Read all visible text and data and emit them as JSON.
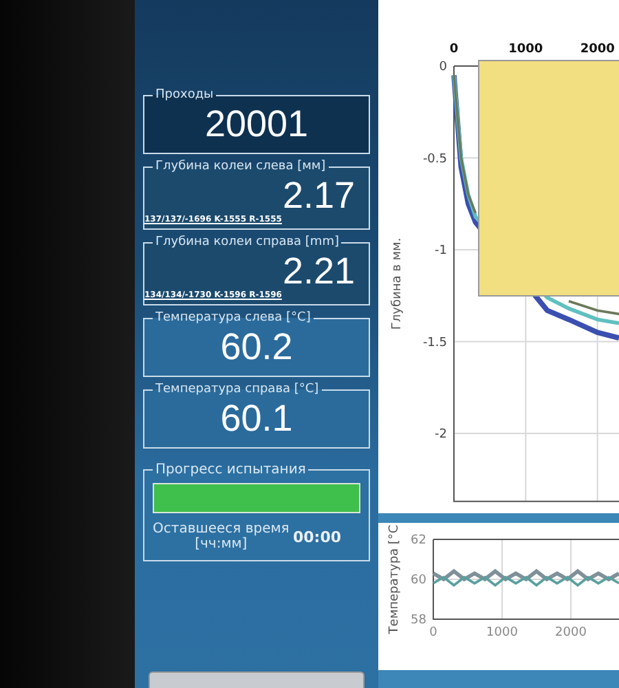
{
  "panels": [
    {
      "kind": "count",
      "label": "Проходы",
      "value": "20001"
    },
    {
      "kind": "depth",
      "label": "Глубина колеи слева [мм]",
      "value": "2.17",
      "note": "137/137/-1696  K-1555 R-1555"
    },
    {
      "kind": "depth",
      "label": "Глубина колеи справа [mm]",
      "value": "2.21",
      "note": "134/134/-1730  K-1596 R-1596"
    },
    {
      "kind": "temperature",
      "label": "Температура слева [°C]",
      "value": "60.2"
    },
    {
      "kind": "temperature",
      "label": "Температура справа [°C]",
      "value": "60.1"
    }
  ],
  "progress": {
    "label": "Прогресс испытания",
    "level": 1,
    "remaining_label": "Оставшееся время",
    "remaining_unit": "[чч:мм]",
    "remaining_value": "00:00"
  },
  "depth_chart": {
    "chart_data": {
      "type": "line",
      "ylabel": "Глубина в мм.",
      "xticks": [
        0,
        1000,
        2000
      ],
      "yticks": [
        {
          "value": 0,
          "label": "0"
        },
        {
          "value": -0.5,
          "label": "-0.5"
        },
        {
          "value": -1,
          "label": "-1"
        },
        {
          "value": -1.5,
          "label": "-1.5"
        },
        {
          "value": -2,
          "label": "-2"
        }
      ],
      "ylim": [
        -2.37,
        0
      ],
      "xlim": [
        0,
        2300
      ],
      "grid": true,
      "x": [
        0,
        100,
        200,
        300,
        1300,
        1600,
        2000,
        2300
      ],
      "series": [
        {
          "color": "#3a4fb0",
          "values": [
            -0.05,
            -0.55,
            -0.75,
            -0.85,
            -1.33,
            -1.38,
            -1.45,
            -1.48
          ]
        },
        {
          "color": "#5fc0c0",
          "values": [
            -0.05,
            -0.5,
            -0.7,
            -0.82,
            -1.26,
            -1.32,
            -1.38,
            -1.4
          ]
        },
        {
          "color": "#6b7a5a",
          "values": [
            -0.05,
            -0.5,
            -0.7,
            -0.8,
            null,
            -1.28,
            -1.33,
            -1.35
          ]
        }
      ]
    }
  },
  "temperature_chart": {
    "chart_data": {
      "type": "line",
      "ylabel": "Температура [°С",
      "xticks": [
        0,
        1000,
        2000
      ],
      "yticks": [
        58,
        60,
        62
      ],
      "ylim": [
        58,
        62
      ],
      "xlim": [
        0,
        2700
      ],
      "grid": true,
      "x": [
        0,
        150,
        300,
        450,
        600,
        750,
        900,
        1050,
        1200,
        1350,
        1500,
        1650,
        1800,
        1950,
        2100,
        2250,
        2400,
        2550,
        2700
      ],
      "series": [
        {
          "color": "#7f9098",
          "values": [
            60.3,
            60.0,
            60.4,
            60.0,
            60.3,
            60.0,
            60.4,
            60.0,
            60.3,
            60.0,
            60.4,
            60.0,
            60.3,
            60.0,
            60.4,
            60.0,
            60.3,
            60.0,
            60.3
          ]
        },
        {
          "color": "#5aa0a0",
          "values": [
            59.8,
            60.1,
            59.7,
            60.1,
            59.8,
            60.1,
            59.7,
            60.1,
            59.8,
            60.1,
            59.7,
            60.1,
            59.8,
            60.1,
            59.7,
            60.1,
            59.8,
            60.1,
            59.8
          ]
        }
      ]
    }
  }
}
